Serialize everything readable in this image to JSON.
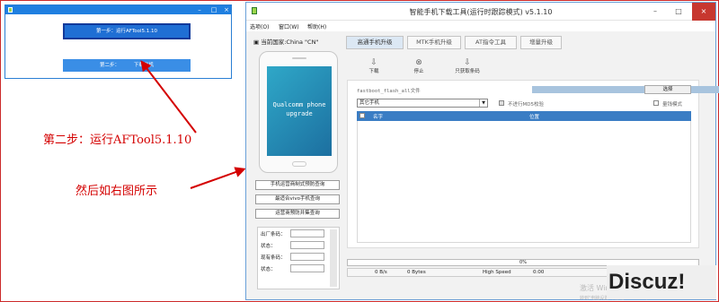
{
  "small_window": {
    "step1_label": "第一步：运行AFTool5.1.10",
    "step2_left": "第二步：",
    "step2_right": "下载刷机"
  },
  "annotations": {
    "step2_text": "第二步：运行AFTool5.1.10",
    "then_text": "然后如右图所示",
    "color": "#d40000"
  },
  "main_window": {
    "title": "智能手机下载工具(运行时跟踪模式)  v5.1.10",
    "menu": [
      "选项(O)",
      "窗口(W)",
      "帮助(H)"
    ],
    "country": "当前国家:China \"CN\"",
    "phone_screen": [
      "Qualcomm phone",
      "upgrade"
    ],
    "left_buttons": [
      "手机运营商制式预防查询",
      "最适合vivo手机查询",
      "运营商预防并集查询"
    ],
    "barcode_fields": [
      "出厂条码：",
      "状态：",
      "现有条码：",
      "状态："
    ],
    "tabs": [
      "高通手机升级",
      "MTK手机升级",
      "AT指令工具",
      "增量升级"
    ],
    "toolbar": [
      {
        "icon": "download-icon",
        "label": "下载"
      },
      {
        "icon": "stop-icon",
        "label": "停止"
      },
      {
        "icon": "barcode-icon",
        "label": "只获取条码"
      }
    ],
    "file_label": "fastboot_flash_all文件",
    "select_button": "选择",
    "combo_value": "其它手机",
    "no_md5_check": "不进行MD5校验",
    "dev_mode": "量钱模式",
    "list_headers": [
      "名字",
      "位置"
    ],
    "progress": "0%",
    "status": [
      "0 B/s",
      "0 Bytes",
      "High Speed",
      "0:00"
    ],
    "watermark": "激活 Windows",
    "watermark2": "转到\"电脑设置\"以激活 Windows。"
  },
  "discuz_logo": "Discuz!"
}
